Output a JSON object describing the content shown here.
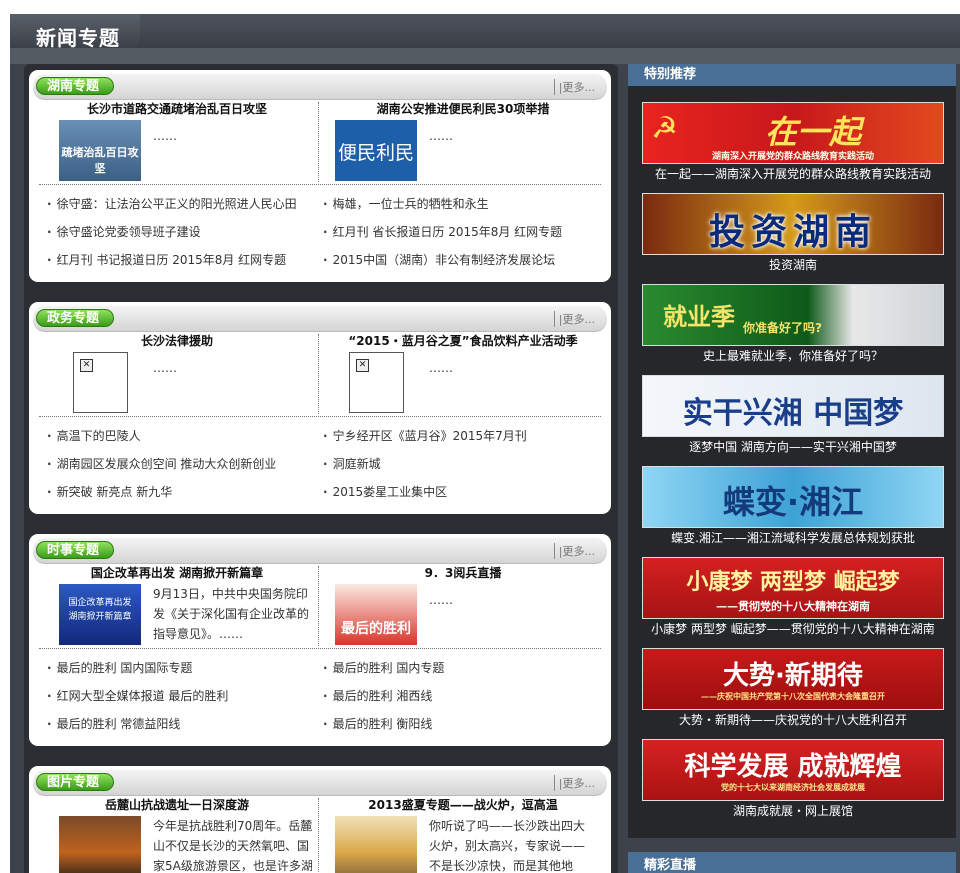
{
  "header": {
    "title": "新闻专题"
  },
  "more_label": "|更多...",
  "ellipsis": "……",
  "sections": [
    {
      "label": "湖南专题",
      "left": {
        "title": "长沙市道路交通疏堵治乱百日攻坚",
        "img_text": "疏堵治乱百日攻坚",
        "desc": "……"
      },
      "right": {
        "title": "湖南公安推进便民利民30项举措",
        "img_text": "便民利民",
        "desc": "……"
      },
      "list_left": [
        "徐守盛：让法治公平正义的阳光照进人民心田",
        "徐守盛论党委领导班子建设",
        "红月刊 书记报道日历 2015年8月 红网专题"
      ],
      "list_right": [
        "梅雄，一位士兵的牺牲和永生",
        "红月刊 省长报道日历 2015年8月 红网专题",
        "2015中国（湖南）非公有制经济发展论坛"
      ]
    },
    {
      "label": "政务专题",
      "left": {
        "title": "长沙法律援助",
        "desc": "……"
      },
      "right": {
        "title": "“2015・蓝月谷之夏”食品饮料产业活动季",
        "desc": "……"
      },
      "list_left": [
        "高温下的巴陵人",
        "湖南园区发展众创空间 推动大众创新创业",
        "新突破 新亮点 新九华"
      ],
      "list_right": [
        "宁乡经开区《蓝月谷》2015年7月刊",
        "洞庭新城",
        "2015娄星工业集中区"
      ]
    },
    {
      "label": "时事专题",
      "left": {
        "title": "国企改革再出发 湖南掀开新篇章",
        "img_text": "国企改革再出发 湖南掀开新篇章",
        "desc": "9月13日，中共中央国务院印发《关于深化国有企业改革的指导意见》。……"
      },
      "right": {
        "title": "9．3阅兵直播",
        "img_text": "最后的胜利",
        "desc": "……"
      },
      "list_left": [
        "最后的胜利 国内国际专题",
        "红网大型全媒体报道 最后的胜利",
        "最后的胜利 常德益阳线"
      ],
      "list_right": [
        "最后的胜利 国内专题",
        "最后的胜利 湘西线",
        "最后的胜利 衡阳线"
      ]
    },
    {
      "label": "图片专题",
      "left": {
        "title": "岳麓山抗战遗址一日深度游",
        "desc": "今年是抗战胜利70周年。岳麓山不仅是长沙的天然氧吧、国家5A级旅游景区，也是许多湖"
      },
      "right": {
        "title": "2013盛夏专题——战火炉，逗高温",
        "desc": "你听说了吗——长沙跌出四大火炉，别太高兴，专家说——不是长沙凉快，而是其他地"
      }
    }
  ],
  "sidebar": {
    "title": "特别推荐",
    "banners": [
      {
        "text": "在一起",
        "sub": "湖南深入开展党的群众路线教育实践活动",
        "caption": "在一起——湖南深入开展党的群众路线教育实践活动",
        "bg": "#c8181b"
      },
      {
        "text": "投资湖南",
        "caption": "投资湖南",
        "bg": "#b8860b"
      },
      {
        "text": "就业季",
        "sub": "你准备好了吗?",
        "caption": "史上最难就业季，你准备好了吗？",
        "bg": "#1e7a2e"
      },
      {
        "text": "实干兴湘 中国梦",
        "caption": "逐梦中国 湖南方向——实干兴湘中国梦",
        "bg": "#e8eef5"
      },
      {
        "text": "蝶变·湘江",
        "caption": "蝶变.湘江——湘江流域科学发展总体规划获批",
        "bg": "#5ab6e0"
      },
      {
        "text": "小康梦 两型梦 崛起梦",
        "sub": "——贯彻党的十八大精神在湖南",
        "caption": "小康梦 两型梦 崛起梦——贯彻党的十八大精神在湖南",
        "bg": "#c01818"
      },
      {
        "text": "大势·新期待",
        "sub": "——庆祝中国共产党第十八次全国代表大会隆重召开",
        "caption": "大势・新期待——庆祝党的十八大胜利召开",
        "bg": "#b51212"
      },
      {
        "text": "科学发展 成就辉煌",
        "sub": "党的十七大以来湖南经济社会发展成就展",
        "caption": "湖南成就展・网上展馆",
        "bg": "#c41a1a"
      }
    ],
    "title2": "精彩直播"
  }
}
